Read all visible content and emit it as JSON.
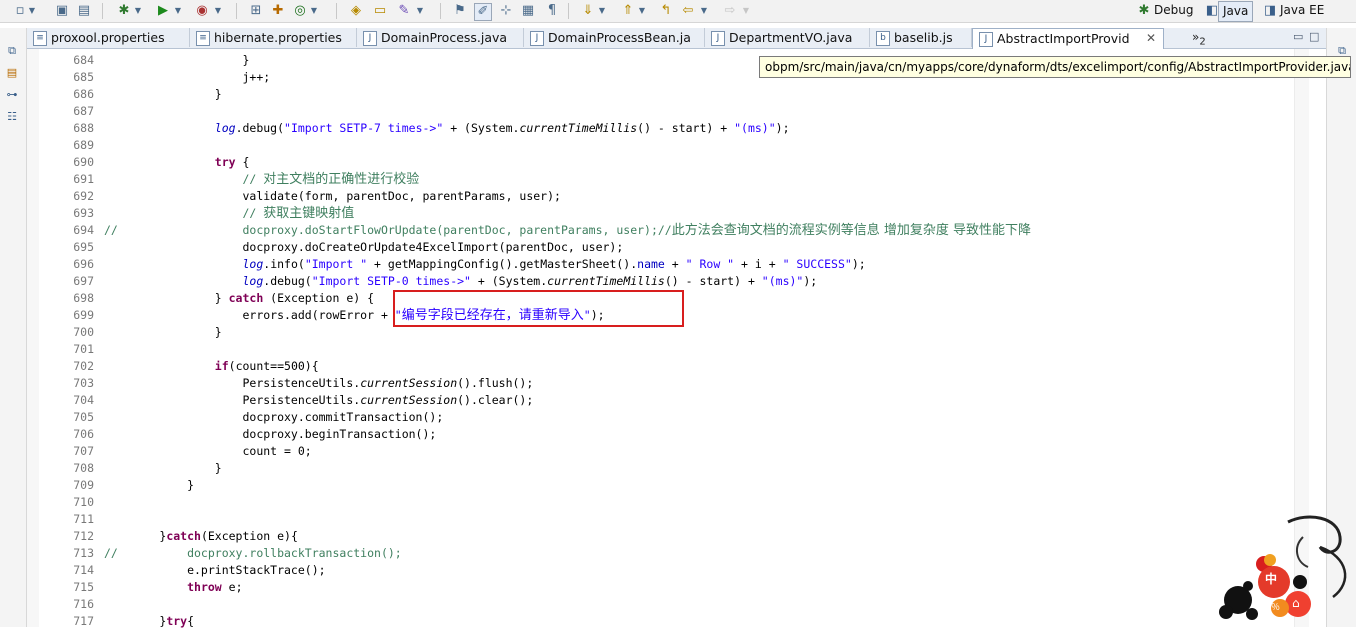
{
  "toolbar": {
    "perspectives": [
      {
        "label": "Debug",
        "active": false
      },
      {
        "label": "Java",
        "active": true
      },
      {
        "label": "Java EE",
        "active": false
      }
    ]
  },
  "tabs": [
    {
      "label": "proxool.properties",
      "active": false
    },
    {
      "label": "hibernate.properties",
      "active": false
    },
    {
      "label": "DomainProcess.java",
      "active": false
    },
    {
      "label": "DomainProcessBean.ja",
      "active": false
    },
    {
      "label": "DepartmentVO.java",
      "active": false
    },
    {
      "label": "baselib.js",
      "active": false
    },
    {
      "label": "AbstractImportProvid",
      "active": true
    }
  ],
  "tab_overflow": {
    "symbol": "»",
    "count": "2"
  },
  "tooltip": "obpm/src/main/java/cn/myapps/core/dynaform/dts/excelimport/config/AbstractImportProvider.java",
  "code_lines": [
    {
      "n": "684",
      "parts": [
        [
          "",
          "                    }"
        ]
      ]
    },
    {
      "n": "685",
      "parts": [
        [
          "",
          "                    j++;"
        ]
      ]
    },
    {
      "n": "686",
      "parts": [
        [
          "",
          "                }"
        ]
      ]
    },
    {
      "n": "687",
      "parts": [
        [
          "",
          ""
        ]
      ]
    },
    {
      "n": "688",
      "parts": [
        [
          "",
          "                "
        ],
        [
          "fld ital",
          "log"
        ],
        [
          "",
          ".debug("
        ],
        [
          "str",
          "\"Import SETP-7 times->\""
        ],
        [
          "",
          " + (System."
        ],
        [
          "ital",
          "currentTimeMillis"
        ],
        [
          "",
          "() - start) + "
        ],
        [
          "str",
          "\"(ms)\""
        ],
        [
          "",
          ");"
        ]
      ]
    },
    {
      "n": "689",
      "parts": [
        [
          "",
          ""
        ]
      ]
    },
    {
      "n": "690",
      "parts": [
        [
          "",
          "                "
        ],
        [
          "kw",
          "try"
        ],
        [
          "",
          " {"
        ]
      ]
    },
    {
      "n": "691",
      "parts": [
        [
          "",
          "                    "
        ],
        [
          "cmt",
          "// "
        ],
        [
          "cmt cjk",
          "对主文档的正确性进行校验"
        ]
      ]
    },
    {
      "n": "692",
      "parts": [
        [
          "",
          "                    validate(form, parentDoc, parentParams, user);"
        ]
      ]
    },
    {
      "n": "693",
      "parts": [
        [
          "",
          "                    "
        ],
        [
          "cmt",
          "// "
        ],
        [
          "cmt cjk",
          "获取主键映射值"
        ]
      ]
    },
    {
      "n": "694",
      "parts": [
        [
          "cmt",
          "//                  docproxy.doStartFlowOrUpdate(parentDoc, parentParams, user);//"
        ],
        [
          "cmt cjk",
          "此方法会查询文档的流程实例等信息 增加复杂度 导致性能下降"
        ]
      ]
    },
    {
      "n": "695",
      "parts": [
        [
          "",
          "                    docproxy.doCreateOrUpdate4ExcelImport(parentDoc, user);"
        ]
      ]
    },
    {
      "n": "696",
      "parts": [
        [
          "",
          "                    "
        ],
        [
          "fld ital",
          "log"
        ],
        [
          "",
          ".info("
        ],
        [
          "str",
          "\"Import \""
        ],
        [
          "",
          " + getMappingConfig().getMasterSheet()."
        ],
        [
          "fld",
          "name"
        ],
        [
          "",
          " + "
        ],
        [
          "str",
          "\" Row \""
        ],
        [
          "",
          " + i + "
        ],
        [
          "str",
          "\" SUCCESS\""
        ],
        [
          "",
          ");"
        ]
      ]
    },
    {
      "n": "697",
      "parts": [
        [
          "",
          "                    "
        ],
        [
          "fld ital",
          "log"
        ],
        [
          "",
          ".debug("
        ],
        [
          "str",
          "\"Import SETP-0 times->\""
        ],
        [
          "",
          " + (System."
        ],
        [
          "ital",
          "currentTimeMillis"
        ],
        [
          "",
          "() - start) + "
        ],
        [
          "str",
          "\"(ms)\""
        ],
        [
          "",
          ");"
        ]
      ]
    },
    {
      "n": "698",
      "parts": [
        [
          "",
          "                } "
        ],
        [
          "kw",
          "catch"
        ],
        [
          "",
          " (Exception e) {"
        ]
      ]
    },
    {
      "n": "699",
      "parts": [
        [
          "",
          "                    errors.add(rowError + "
        ],
        [
          "str",
          "\""
        ],
        [
          "str cjk",
          "编号字段已经存在，请重新导入"
        ],
        [
          "str",
          "\""
        ],
        [
          "",
          ");"
        ]
      ]
    },
    {
      "n": "700",
      "parts": [
        [
          "",
          "                }"
        ]
      ]
    },
    {
      "n": "701",
      "parts": [
        [
          "",
          ""
        ]
      ]
    },
    {
      "n": "702",
      "parts": [
        [
          "",
          "                "
        ],
        [
          "kw",
          "if"
        ],
        [
          "",
          "(count==500){"
        ]
      ]
    },
    {
      "n": "703",
      "parts": [
        [
          "",
          "                    PersistenceUtils."
        ],
        [
          "ital",
          "currentSession"
        ],
        [
          "",
          "().flush();"
        ]
      ]
    },
    {
      "n": "704",
      "parts": [
        [
          "",
          "                    PersistenceUtils."
        ],
        [
          "ital",
          "currentSession"
        ],
        [
          "",
          "().clear();"
        ]
      ]
    },
    {
      "n": "705",
      "parts": [
        [
          "",
          "                    docproxy.commitTransaction();"
        ]
      ]
    },
    {
      "n": "706",
      "parts": [
        [
          "",
          "                    docproxy.beginTransaction();"
        ]
      ]
    },
    {
      "n": "707",
      "parts": [
        [
          "",
          "                    count = 0;"
        ]
      ]
    },
    {
      "n": "708",
      "parts": [
        [
          "",
          "                }"
        ]
      ]
    },
    {
      "n": "709",
      "parts": [
        [
          "",
          "            }"
        ]
      ]
    },
    {
      "n": "710",
      "parts": [
        [
          "",
          ""
        ]
      ]
    },
    {
      "n": "711",
      "parts": [
        [
          "",
          ""
        ]
      ]
    },
    {
      "n": "712",
      "parts": [
        [
          "",
          "        }"
        ],
        [
          "kw",
          "catch"
        ],
        [
          "",
          "(Exception e){"
        ]
      ]
    },
    {
      "n": "713",
      "parts": [
        [
          "cmt",
          "//          docproxy.rollbackTransaction();"
        ]
      ]
    },
    {
      "n": "714",
      "parts": [
        [
          "",
          "            e.printStackTrace();"
        ]
      ]
    },
    {
      "n": "715",
      "parts": [
        [
          "",
          "            "
        ],
        [
          "kw",
          "throw"
        ],
        [
          "",
          " e;"
        ]
      ]
    },
    {
      "n": "716",
      "parts": [
        [
          "",
          ""
        ]
      ]
    },
    {
      "n": "717",
      "parts": [
        [
          "",
          "        }"
        ],
        [
          "kw",
          "try"
        ],
        [
          "",
          "{"
        ]
      ]
    }
  ],
  "ime_badge": "中",
  "colors": {
    "keyword": "#7f0055",
    "string": "#2a00ff",
    "comment": "#3f7f5f",
    "field": "#0000c0",
    "annotation_box": "#d81e1e",
    "tooltip_bg": "#ffffe1"
  }
}
